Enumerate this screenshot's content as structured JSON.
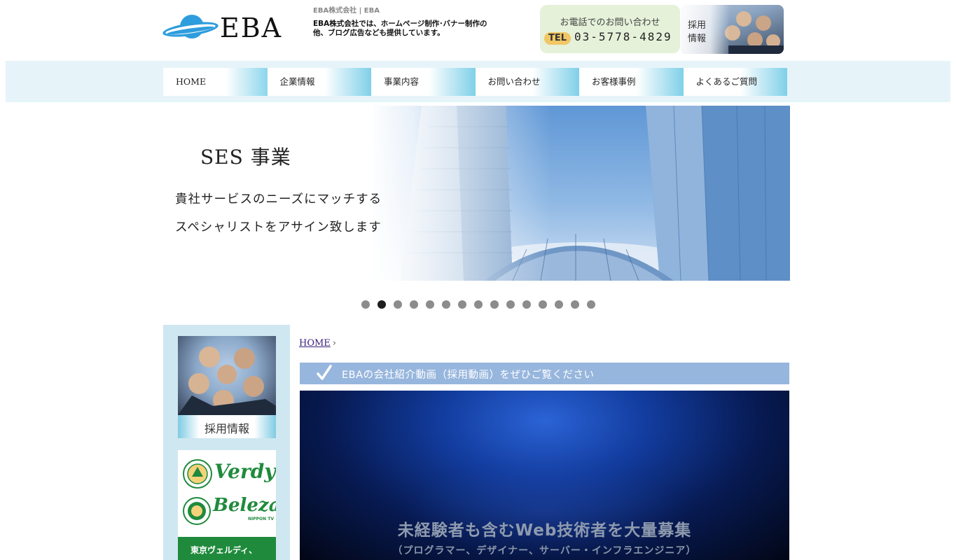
{
  "header": {
    "logo_text": "EBA",
    "site_title": "EBA株式会社 | EBA",
    "site_desc": "EBA株式会社では、ホームページ制作･バナー制作の他、ブログ広告なども提供しています。",
    "contact": {
      "label": "お電話でのお問い合わせ",
      "tel_badge": "TEL",
      "tel_number": "03-5778-4829"
    },
    "recruit_banner": "採用情報"
  },
  "nav": {
    "items": [
      {
        "label": "HOME"
      },
      {
        "label": "企業情報"
      },
      {
        "label": "事業内容"
      },
      {
        "label": "お問い合わせ"
      },
      {
        "label": "お客様事例"
      },
      {
        "label": "よくあるご質問"
      }
    ]
  },
  "hero": {
    "title": "SES 事業",
    "line1": "貴社サービスのニーズにマッチする",
    "line2": "スペシャリストをアサイン致します",
    "slide_count": 15,
    "active_slide": 2
  },
  "sidebar": {
    "recruit_label": "採用情報",
    "verdy_word": "Verdy",
    "beleza_word": "Beleza",
    "nippon_tv": "NIPPON TV",
    "verdy_caption": "東京ヴェルディ、"
  },
  "main": {
    "breadcrumb_home": "HOME",
    "section_title": "EBAの会社紹介動画（採用動画）をぜひご覧ください",
    "video": {
      "caption1": "未経験者も含むWeb技術者を大量募集",
      "caption2": "（プログラマー、デザイナー、サーバー・インフラエンジニア）"
    }
  },
  "colors": {
    "nav_band": "#e6f4fa",
    "nav_accent": "#7fd0e8",
    "contact_bg": "#e5f1d9",
    "tel_badge": "#f1c766",
    "section_head": "#97b6dd",
    "sidebar_bg": "#cfe7f0",
    "verdy_green": "#1f8a3c"
  }
}
